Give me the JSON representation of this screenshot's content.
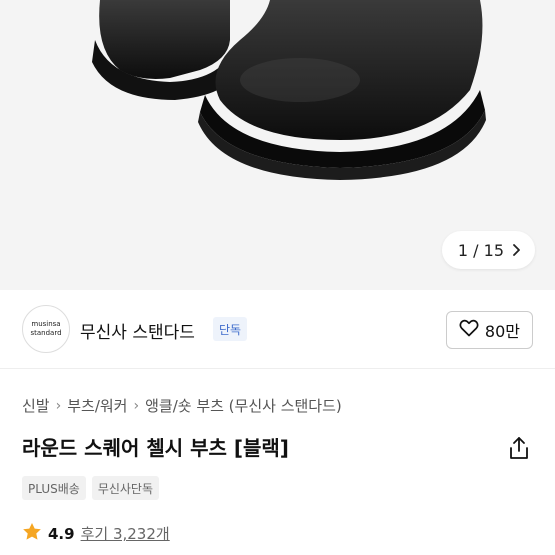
{
  "gallery": {
    "image_alt": "black leather chelsea boots",
    "counter_text": "1 / 15"
  },
  "brand": {
    "logo_line1": "musinsa",
    "logo_line2": "standard",
    "name": "무신사 스탠다드",
    "badge": "단독",
    "like_count": "80만"
  },
  "breadcrumb": [
    "신발",
    "부츠/워커",
    "앵클/숏 부츠 (무신사 스탠다드)"
  ],
  "product": {
    "title": "라운드 스퀘어 첼시 부츠 [블랙]",
    "tags": [
      "PLUS배송",
      "무신사단독"
    ],
    "rating": "4.9",
    "reviews_text": "후기 3,232개"
  },
  "colors": {
    "accent_star": "#f5a623",
    "badge_blue": "#3f6ccc"
  }
}
